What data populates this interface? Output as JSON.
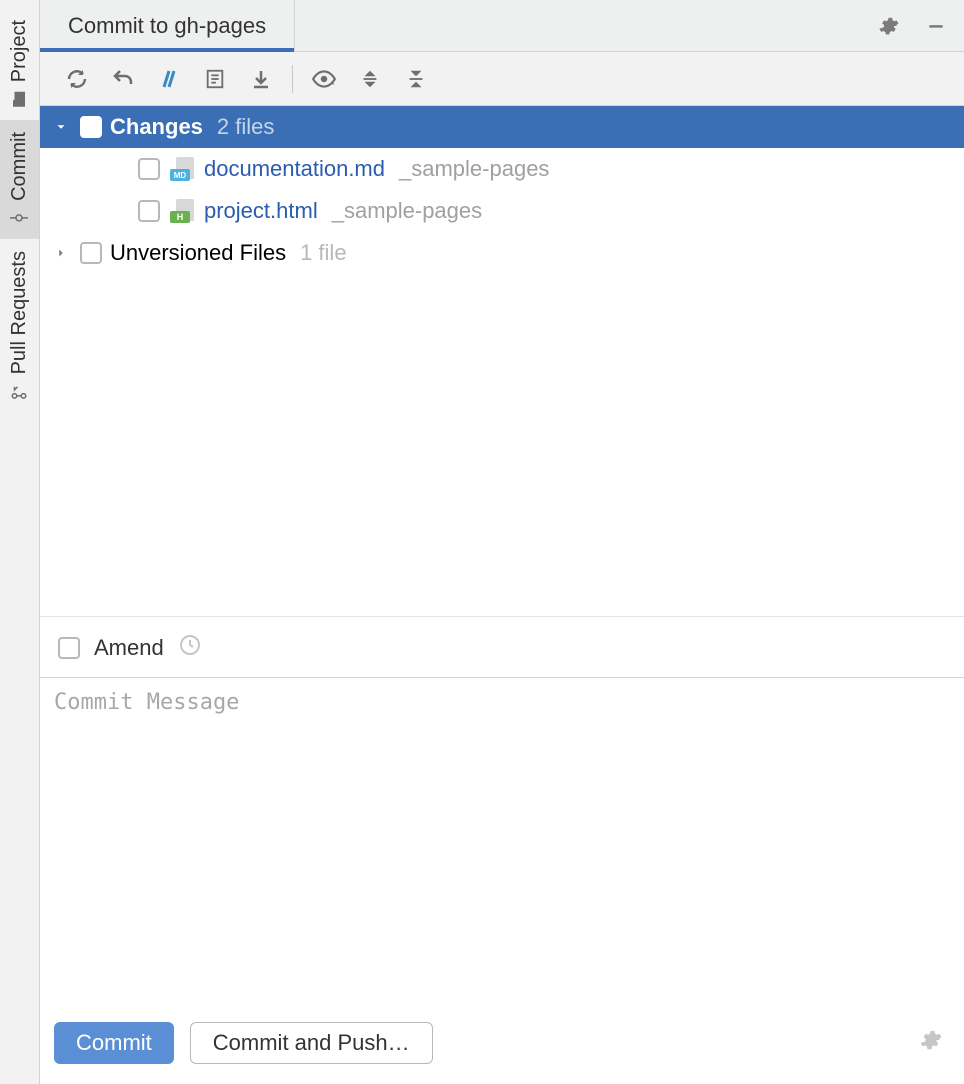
{
  "sidebar": {
    "tabs": [
      {
        "label": "Project"
      },
      {
        "label": "Commit"
      },
      {
        "label": "Pull Requests"
      }
    ]
  },
  "header": {
    "tab_title": "Commit to gh-pages"
  },
  "tree": {
    "changes": {
      "label": "Changes",
      "count_label": "2 files",
      "files": [
        {
          "name": "documentation.md",
          "path": "_sample-pages",
          "type": "md"
        },
        {
          "name": "project.html",
          "path": "_sample-pages",
          "type": "html"
        }
      ]
    },
    "unversioned": {
      "label": "Unversioned Files",
      "count_label": "1 file"
    }
  },
  "amend": {
    "label": "Amend"
  },
  "message": {
    "placeholder": "Commit Message"
  },
  "buttons": {
    "commit": "Commit",
    "commit_push": "Commit and Push…"
  }
}
